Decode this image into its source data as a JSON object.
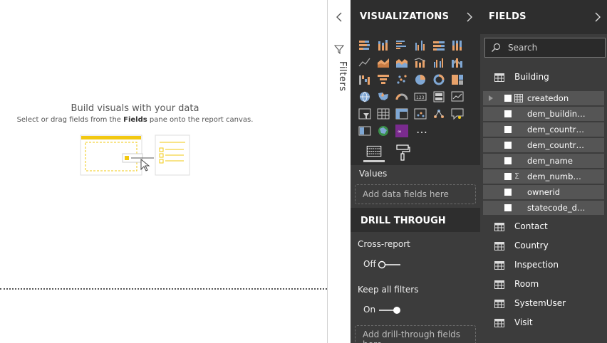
{
  "canvas": {
    "hint_title": "Build visuals with your data",
    "hint_sub_before": "Select or drag fields from the ",
    "hint_sub_bold": "Fields",
    "hint_sub_after": " pane onto the report canvas."
  },
  "filters": {
    "label": "Filters"
  },
  "visualizations": {
    "title": "VISUALIZATIONS",
    "more_icons": "…",
    "values_label": "Values",
    "values_placeholder": "Add data fields here",
    "drill_through_title": "DRILL THROUGH",
    "cross_report_label": "Cross-report",
    "cross_report_state": "Off",
    "keep_filters_label": "Keep all filters",
    "keep_filters_state": "On",
    "drill_placeholder": "Add drill-through fields here"
  },
  "fields": {
    "title": "FIELDS",
    "search_placeholder": "Search",
    "tables": [
      {
        "name": "Building"
      },
      {
        "name": "Contact"
      },
      {
        "name": "Country"
      },
      {
        "name": "Inspection"
      },
      {
        "name": "Room"
      },
      {
        "name": "SystemUser"
      },
      {
        "name": "Visit"
      }
    ],
    "building_fields": [
      {
        "name": "createdon",
        "icon": "calendar-table-icon"
      },
      {
        "name": "dem_buildin…",
        "icon": ""
      },
      {
        "name": "dem_countr…",
        "icon": ""
      },
      {
        "name": "dem_countr…",
        "icon": ""
      },
      {
        "name": "dem_name",
        "icon": ""
      },
      {
        "name": "dem_numb…",
        "icon": "sigma-icon"
      },
      {
        "name": "ownerid",
        "icon": ""
      },
      {
        "name": "statecode_d…",
        "icon": ""
      }
    ]
  },
  "colors": {
    "pane_dark": "#2e2e2e",
    "pane_mid": "#3c3c3c",
    "field_row": "#555555",
    "accent_orange": "#e8a26a",
    "accent_blue": "#7fa7d4",
    "accent_yellow": "#f2c811",
    "custom_visual_purple": "#7a2b8e"
  }
}
